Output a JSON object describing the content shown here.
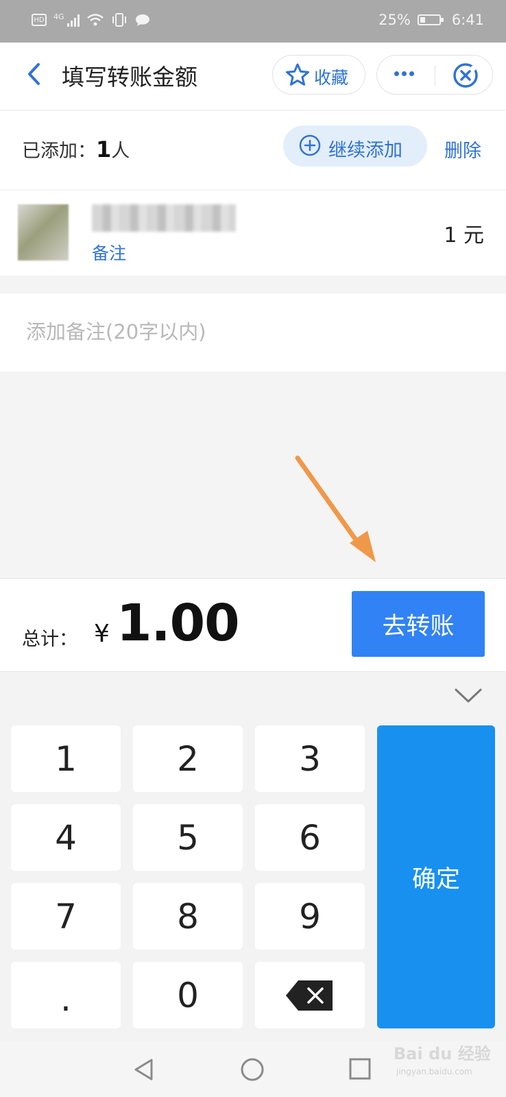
{
  "status_bar": {
    "hd": "HD",
    "network": "4G",
    "battery": "25%",
    "time": "6:41"
  },
  "header": {
    "title": "填写转账金额",
    "favorite_label": "收藏"
  },
  "added": {
    "label": "已添加：",
    "count": "1",
    "unit": "人",
    "add_more_label": "继续添加",
    "delete_label": "删除"
  },
  "payee": {
    "memo_link": "备注",
    "amount": "1 元"
  },
  "note": {
    "placeholder": "添加备注(20字以内)",
    "value": ""
  },
  "total": {
    "label": "总计：",
    "currency": "¥",
    "value": "1.00",
    "button_label": "去转账"
  },
  "keypad": {
    "keys": [
      "1",
      "2",
      "3",
      "4",
      "5",
      "6",
      "7",
      "8",
      "9",
      ".",
      "0"
    ],
    "confirm_label": "确定"
  },
  "watermark": {
    "brand": "Bai du 经验",
    "site": "jingyan.baidu.com"
  },
  "colors": {
    "accent": "#2f72d6",
    "button": "#3182f5",
    "confirm": "#1890f0",
    "annotation_arrow": "#f0984a"
  }
}
